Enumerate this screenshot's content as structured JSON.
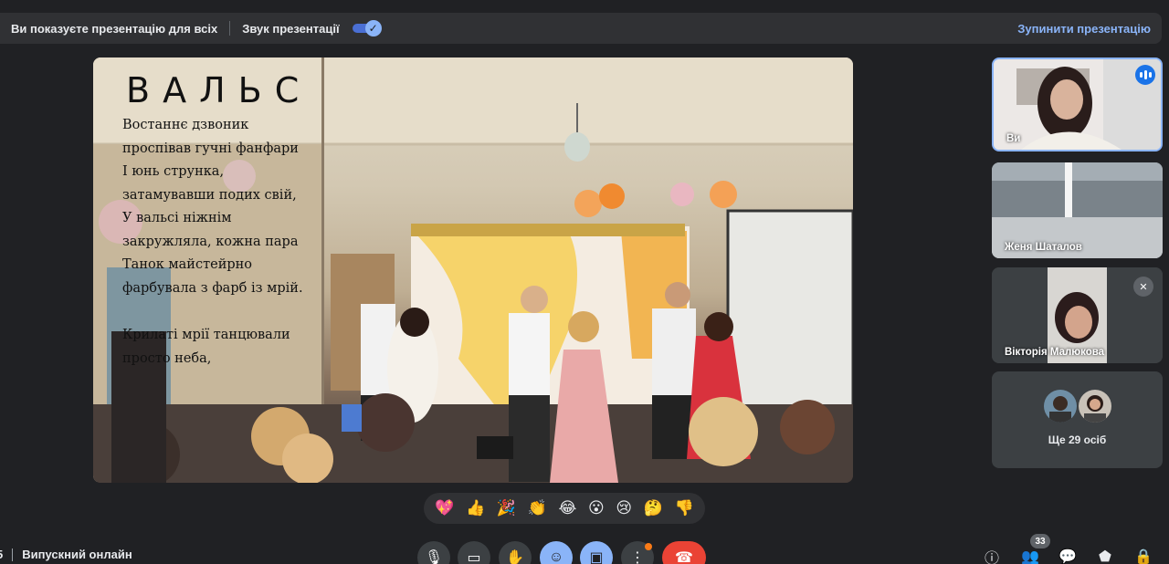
{
  "presentation_bar": {
    "presenting_text": "Ви показуєте презентацію для всіх",
    "audio_label": "Звук презентації",
    "audio_enabled": true,
    "stop_label": "Зупинити презентацію"
  },
  "slide": {
    "title": "ВАЛЬС",
    "poem_lines": [
      "Востаннє дзвоник",
      "проспівав гучні фанфари",
      " І юнь струнка,",
      "затамувавши подих свій,",
      " У вальсі ніжнім",
      "закружляла, кожна пара",
      " Танок майстейрно",
      "фарбувала з фарб із мрій.",
      "",
      " Крилаті мрії танцювали",
      "просто неба,"
    ]
  },
  "reactions": [
    {
      "icon": "heart-icon",
      "glyph": "💖"
    },
    {
      "icon": "thumbs-up-icon",
      "glyph": "👍"
    },
    {
      "icon": "party-popper-icon",
      "glyph": "🎉"
    },
    {
      "icon": "clapping-hands-icon",
      "glyph": "👏"
    },
    {
      "icon": "tears-of-joy-icon",
      "glyph": "😂"
    },
    {
      "icon": "surprised-face-icon",
      "glyph": "😮"
    },
    {
      "icon": "sad-face-icon",
      "glyph": "😢"
    },
    {
      "icon": "thinking-face-icon",
      "glyph": "🤔"
    },
    {
      "icon": "thumbs-down-icon",
      "glyph": "👎"
    }
  ],
  "participants": [
    {
      "name": "Ви",
      "speaking": true
    },
    {
      "name": "Женя Шаталов"
    },
    {
      "name": "Вікторія Малюкова",
      "muted": true
    }
  ],
  "others": {
    "label": "Ще 29 осіб"
  },
  "meeting": {
    "time_fragment": "5",
    "name": "Випускний онлайн"
  },
  "controls": {
    "participant_count": "33",
    "colors": {
      "accent": "#8ab4f8",
      "end_call": "#ea4335",
      "background": "#202124"
    }
  }
}
